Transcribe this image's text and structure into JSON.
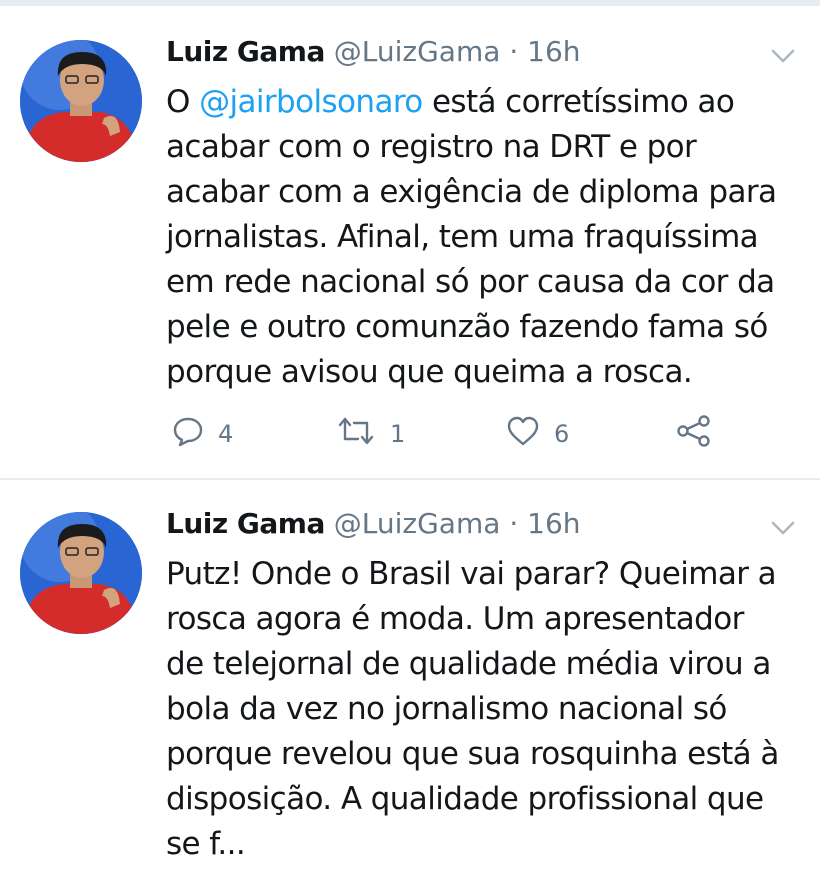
{
  "tweets": [
    {
      "name": "Luiz Gama",
      "handle": "@LuizGama",
      "separator": "·",
      "time": "16h",
      "mention": "@jairbolsonaro",
      "lines": [
        " está corretíssimo ao",
        "acabar com o registro na DRT e por",
        "acabar com a exigência de diploma para",
        "jornalistas. Afinal, tem uma fraquíssima",
        "em rede nacional só por causa da cor da",
        "pele e outro comunzão fazendo fama só",
        "porque avisou que queima a rosca."
      ],
      "prefix": "O ",
      "reply_count": "4",
      "retweet_count": "1",
      "like_count": "6"
    },
    {
      "name": "Luiz Gama",
      "handle": "@LuizGama",
      "separator": "·",
      "time": "16h",
      "lines": [
        "Putz! Onde o Brasil vai parar? Queimar a",
        "rosca agora é moda. Um apresentador",
        "de telejornal de qualidade média virou a",
        "bola da vez no jornalismo nacional só",
        "porque revelou que sua rosquinha está à",
        "disposição. A qualidade profissional que",
        "se f..."
      ]
    }
  ],
  "icons": {
    "reply": "reply-icon",
    "retweet": "retweet-icon",
    "like": "heart-icon",
    "share": "share-icon",
    "caret": "chevron-down-icon"
  },
  "colors": {
    "link": "#1da1f2",
    "muted": "#657786",
    "divider": "#e6ecf0",
    "avatar_bg": "#2a66d3",
    "shirt": "#d42b2b"
  }
}
